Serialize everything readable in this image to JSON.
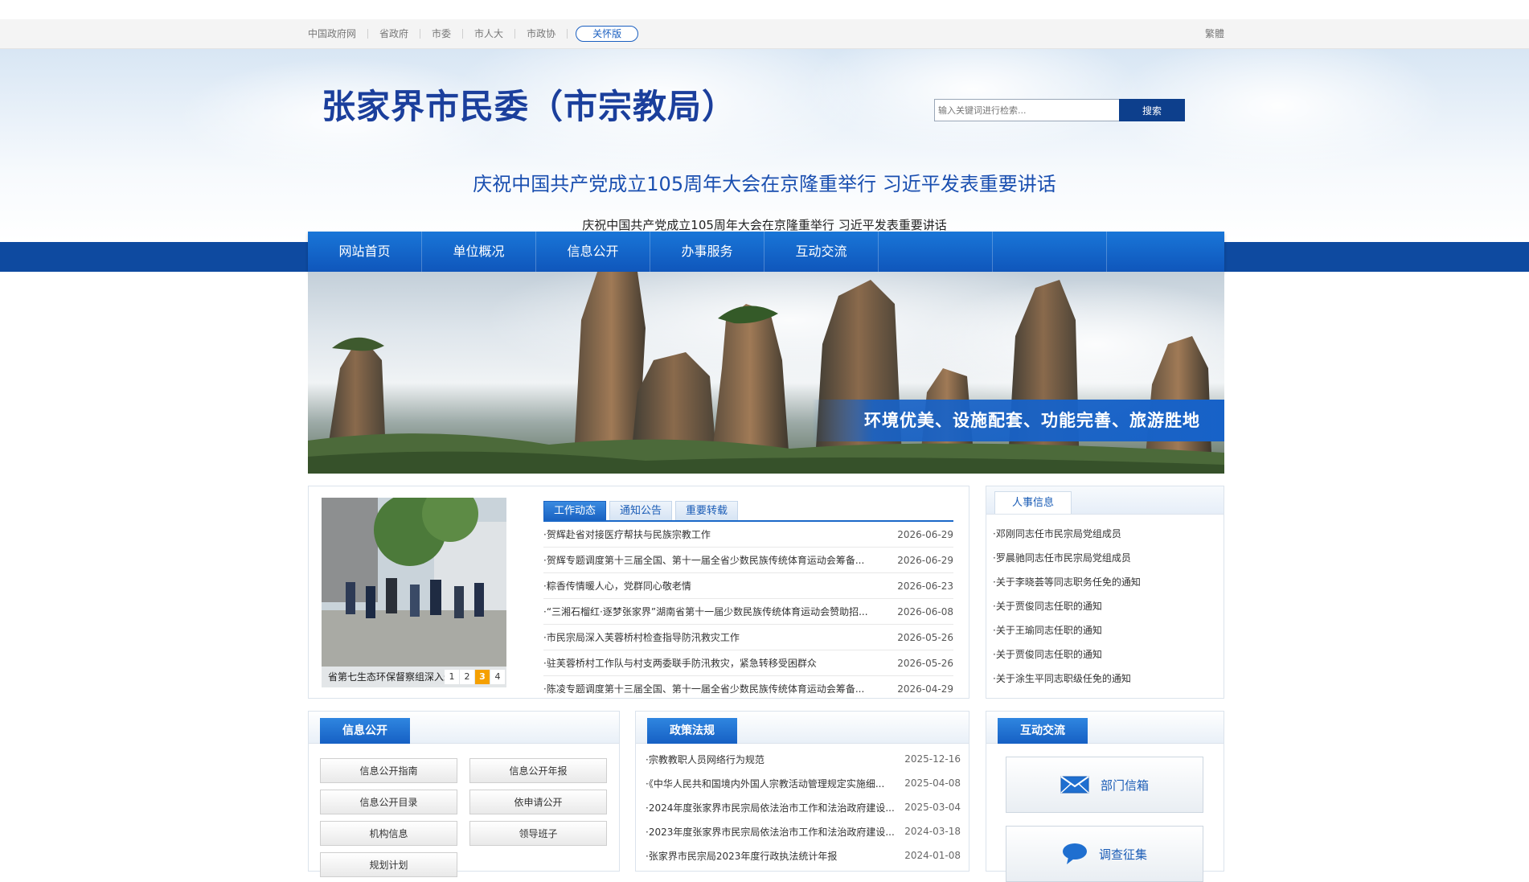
{
  "topbar": {
    "links": [
      "中国政府网",
      "省政府",
      "市委",
      "市人大",
      "市政协"
    ],
    "care_label": "关怀版",
    "fanti_label": "繁體"
  },
  "header": {
    "site_title": "张家界市民委（市宗教局）",
    "search_placeholder": "输入关键词进行检索...",
    "search_button": "搜索",
    "headline": "庆祝中国共产党成立105周年大会在京隆重举行 习近平发表重要讲话",
    "subheadline": "庆祝中国共产党成立105周年大会在京隆重举行 习近平发表重要讲话"
  },
  "nav": {
    "items": [
      "网站首页",
      "单位概况",
      "信息公开",
      "办事服务",
      "互动交流",
      "",
      "",
      ""
    ]
  },
  "banner": {
    "caption": "环境优美、设施配套、功能完善、旅游胜地"
  },
  "news": {
    "photo_caption": "省第七生态环保督察组深入永定区",
    "dots": [
      "1",
      "2",
      "3",
      "4"
    ],
    "active_dot": "3",
    "tabs": [
      "工作动态",
      "通知公告",
      "重要转载"
    ],
    "items": [
      {
        "title": "·贺辉赴省对接医疗帮扶与民族宗教工作",
        "date": "2026-06-29"
      },
      {
        "title": "·贺辉专题调度第十三届全国、第十一届全省少数民族传统体育运动会筹备...",
        "date": "2026-06-29"
      },
      {
        "title": "·粽香传情暖人心，党群同心敬老情",
        "date": "2026-06-23"
      },
      {
        "title": "·“三湘石榴红·逐梦张家界”湖南省第十一届少数民族传统体育运动会赞助招...",
        "date": "2026-06-08"
      },
      {
        "title": "·市民宗局深入芙蓉桥村检查指导防汛救灾工作",
        "date": "2026-05-26"
      },
      {
        "title": "·驻芙蓉桥村工作队与村支两委联手防汛救灾，紧急转移受困群众",
        "date": "2026-05-26"
      },
      {
        "title": "·陈凌专题调度第十三届全国、第十一届全省少数民族传统体育运动会筹备...",
        "date": "2026-04-29"
      }
    ]
  },
  "people": {
    "tab": "人事信息",
    "items": [
      "·邓刚同志任市民宗局党组成员",
      "·罗晨驰同志任市民宗局党组成员",
      "·关于李晓荟等同志职务任免的通知",
      "·关于贾俊同志任职的通知",
      "·关于王瑜同志任职的通知",
      "·关于贾俊同志任职的通知",
      "·关于涂生平同志职级任免的通知"
    ]
  },
  "info": {
    "tab": "信息公开",
    "buttons": [
      "信息公开指南",
      "信息公开年报",
      "信息公开目录",
      "依申请公开",
      "机构信息",
      "领导班子",
      "规划计划"
    ]
  },
  "policy": {
    "tab": "政策法规",
    "items": [
      {
        "title": "·宗教教职人员网络行为规范",
        "date": "2025-12-16"
      },
      {
        "title": "·《中华人民共和国境内外国人宗教活动管理规定实施细...",
        "date": "2025-04-08"
      },
      {
        "title": "·2024年度张家界市民宗局依法治市工作和法治政府建设...",
        "date": "2025-03-04"
      },
      {
        "title": "·2023年度张家界市民宗局依法治市工作和法治政府建设...",
        "date": "2024-03-18"
      },
      {
        "title": "·张家界市民宗局2023年度行政执法统计年报",
        "date": "2024-01-08"
      }
    ]
  },
  "interact": {
    "tab": "互动交流",
    "mailbox": "部门信箱",
    "survey": "调查征集"
  },
  "colors": {
    "brand_blue": "#1762c8",
    "nav_dark": "#0e4aa0",
    "title_blue": "#1b3f9c",
    "accent_orange": "#f5a000"
  }
}
